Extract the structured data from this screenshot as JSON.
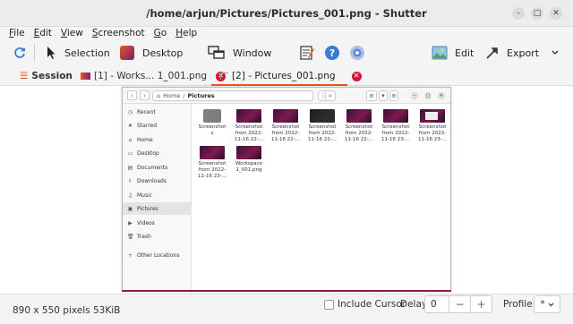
{
  "window": {
    "title": "/home/arjun/Pictures/Pictures_001.png - Shutter",
    "minimize": "–",
    "maximize": "□",
    "close": "✕"
  },
  "menu": [
    "File",
    "Edit",
    "View",
    "Screenshot",
    "Go",
    "Help"
  ],
  "toolbar": {
    "refresh_icon": "refresh-icon",
    "selection": "Selection",
    "desktop": "Desktop",
    "window": "Window",
    "edit": "Edit",
    "export": "Export"
  },
  "tabs": {
    "session": "Session",
    "tab1": "[1] - Works... 1_001.png",
    "tab2": "[2] - Pictures_001.png",
    "close_glyph": "✕"
  },
  "file_manager": {
    "path_home": "Home",
    "path_sep": "/",
    "path_current": "Pictures",
    "sidebar": [
      {
        "icon": "◷",
        "label": "Recent"
      },
      {
        "icon": "★",
        "label": "Starred"
      },
      {
        "icon": "⌂",
        "label": "Home"
      },
      {
        "icon": "▭",
        "label": "Desktop"
      },
      {
        "icon": "▤",
        "label": "Documents"
      },
      {
        "icon": "⇩",
        "label": "Downloads"
      },
      {
        "icon": "♫",
        "label": "Music"
      },
      {
        "icon": "▣",
        "label": "Pictures"
      },
      {
        "icon": "▶",
        "label": "Videos"
      },
      {
        "icon": "🗑",
        "label": "Trash"
      },
      {
        "icon": "+",
        "label": "Other Locations"
      }
    ],
    "files": [
      {
        "name": "Screenshot\ns",
        "thumb": "folder"
      },
      {
        "name": "Screenshot\nfrom 2022-\n11-16 22-...",
        "thumb": "purple"
      },
      {
        "name": "Screenshot\nfrom 2022-\n11-16 22-...",
        "thumb": "purple"
      },
      {
        "name": "Screenshot\nfrom 2022-\n11-16 22-...",
        "thumb": "dark"
      },
      {
        "name": "Screenshot\nfrom 2022-\n11-16 22-...",
        "thumb": "purple"
      },
      {
        "name": "Screenshot\nfrom 2022-\n11-16 23-...",
        "thumb": "purple"
      },
      {
        "name": "Screenshot\nfrom 2022-\n11-16 23-...",
        "thumb": "pinkdialog"
      },
      {
        "name": "Screenshot\nfrom 2022-\n11-16 23-...",
        "thumb": "purple"
      },
      {
        "name": "Workspace\n1_001.png",
        "thumb": "purple"
      }
    ]
  },
  "status": {
    "info": "890 x 550 pixels  53KiB",
    "include_cursor": "Include Cursor",
    "delay_label": "Delay:",
    "delay_value": "0",
    "minus": "−",
    "plus": "+",
    "profile_label": "Profile:",
    "profile_value": "*"
  },
  "colors": {
    "accent": "#e95420",
    "tab_close": "#d6143b",
    "help_icon": "#3a7bd5"
  }
}
